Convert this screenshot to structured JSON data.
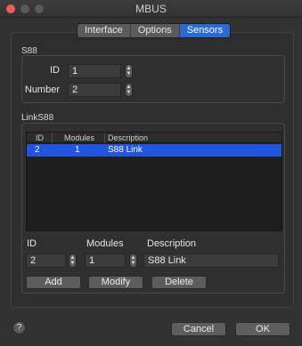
{
  "window": {
    "title": "MBUS"
  },
  "tabs": [
    {
      "label": "Interface"
    },
    {
      "label": "Options"
    },
    {
      "label": "Sensors",
      "active": true
    }
  ],
  "s88": {
    "section_label": "S88",
    "id_label": "ID",
    "id_value": "1",
    "number_label": "Number",
    "number_value": "2"
  },
  "links88": {
    "section_label": "LinkS88",
    "table": {
      "headers": [
        "ID",
        "Modules",
        "Description"
      ],
      "rows": [
        {
          "id": "2",
          "modules": "1",
          "description": "S88 Link",
          "selected": true
        }
      ]
    },
    "editor": {
      "id_label": "ID",
      "modules_label": "Modules",
      "description_label": "Description",
      "id_value": "2",
      "modules_value": "1",
      "description_value": "S88 Link"
    },
    "buttons": {
      "add": "Add",
      "modify": "Modify",
      "delete": "Delete"
    }
  },
  "footer": {
    "help": "?",
    "cancel": "Cancel",
    "ok": "OK"
  },
  "colors": {
    "accent": "#2a6ad6",
    "selection": "#2255dd",
    "close": "#ec5f57"
  },
  "icons": {
    "stepper": "up-down-arrows-icon",
    "help": "question-mark-icon"
  }
}
